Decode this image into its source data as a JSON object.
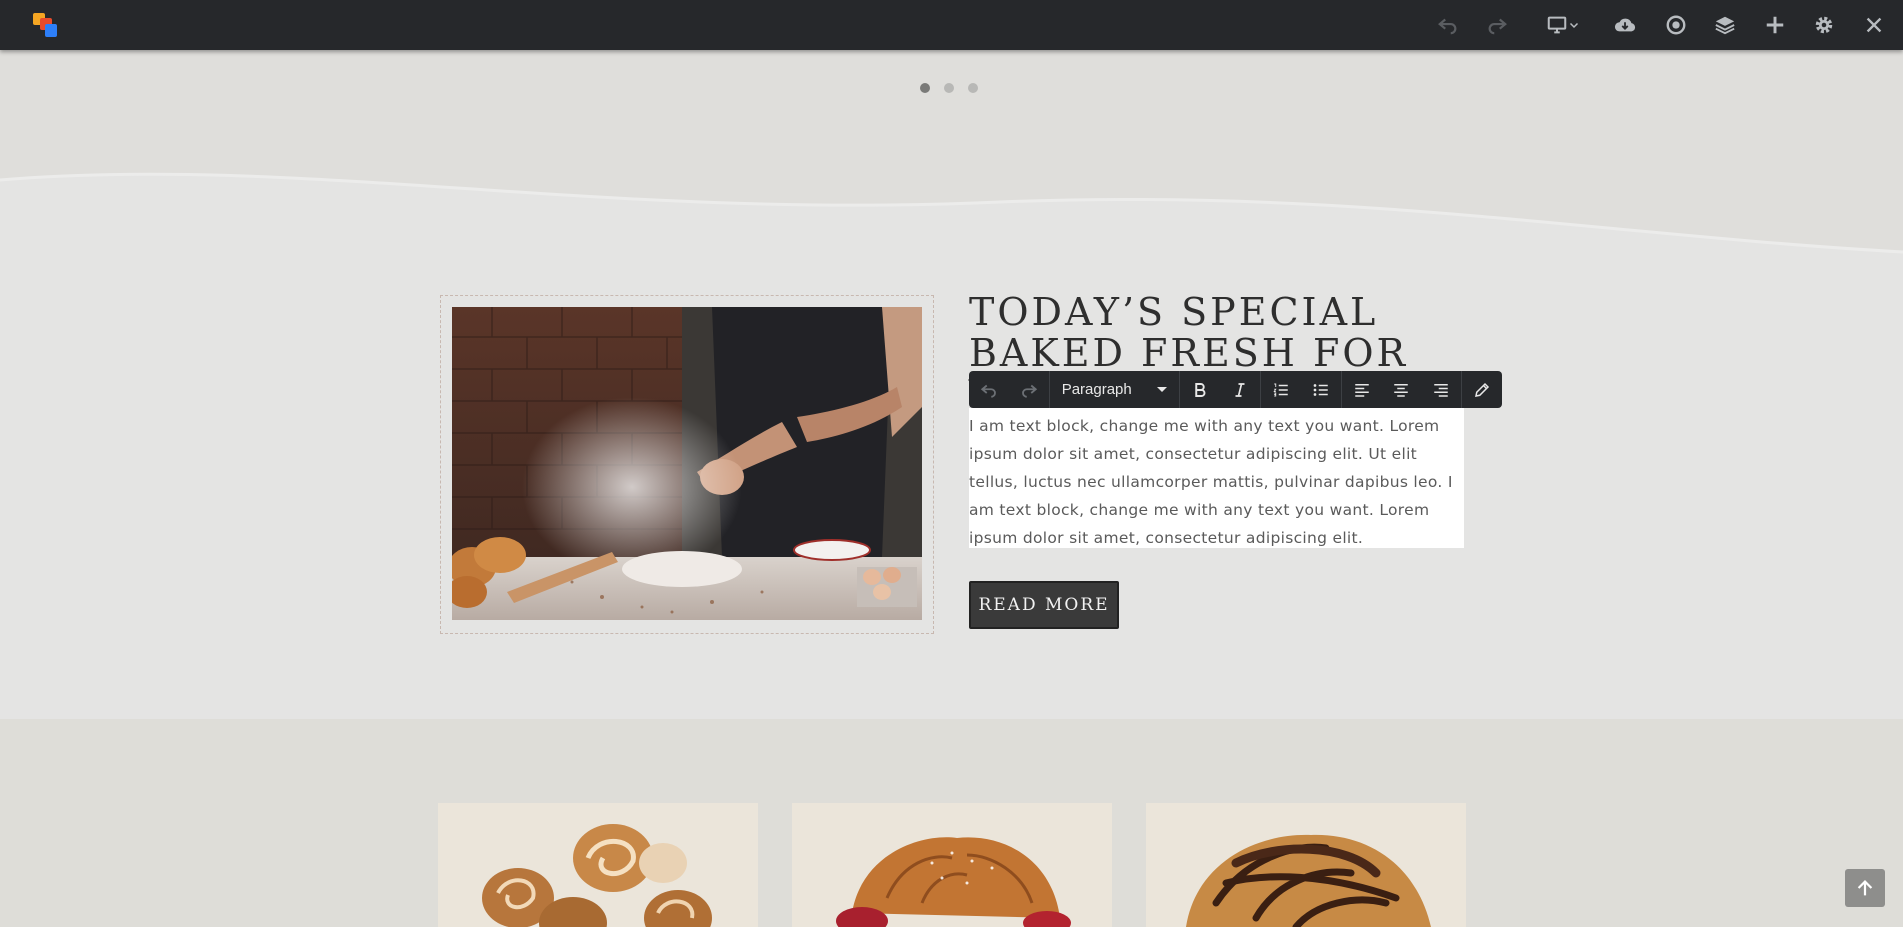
{
  "topbar": {
    "icons": [
      "undo-icon",
      "redo-icon",
      "desktop-icon",
      "chevron-down-icon",
      "cloud-download-icon",
      "preview-icon",
      "layers-icon",
      "plus-icon",
      "gear-icon",
      "close-icon"
    ]
  },
  "carousel": {
    "dot_count": 3,
    "active_index": 0
  },
  "special": {
    "heading_line1": "TODAY’S SPECIAL",
    "heading_line2": "BAKED FRESH FOR YOU",
    "body": "I am text block, change me with any text you want. Lorem ipsum dolor sit amet, consectetur adipiscing elit. Ut elit tellus, luctus nec ullamcorper mattis, pulvinar dapibus leo. I am text block, change me with any text you want. Lorem ipsum dolor sit amet, consectetur adipiscing elit.",
    "button": "READ MORE"
  },
  "editor_toolbar": {
    "format_select": "Paragraph",
    "buttons": [
      "undo-icon",
      "redo-icon",
      "bold-icon",
      "italic-icon",
      "ordered-list-icon",
      "unordered-list-icon",
      "align-left-icon",
      "align-center-icon",
      "align-right-icon",
      "pencil-icon"
    ]
  },
  "colors": {
    "topbar": "#26282b",
    "band": "#dfdedb",
    "section": "#e4e4e3",
    "button": "#3a3a3a"
  }
}
